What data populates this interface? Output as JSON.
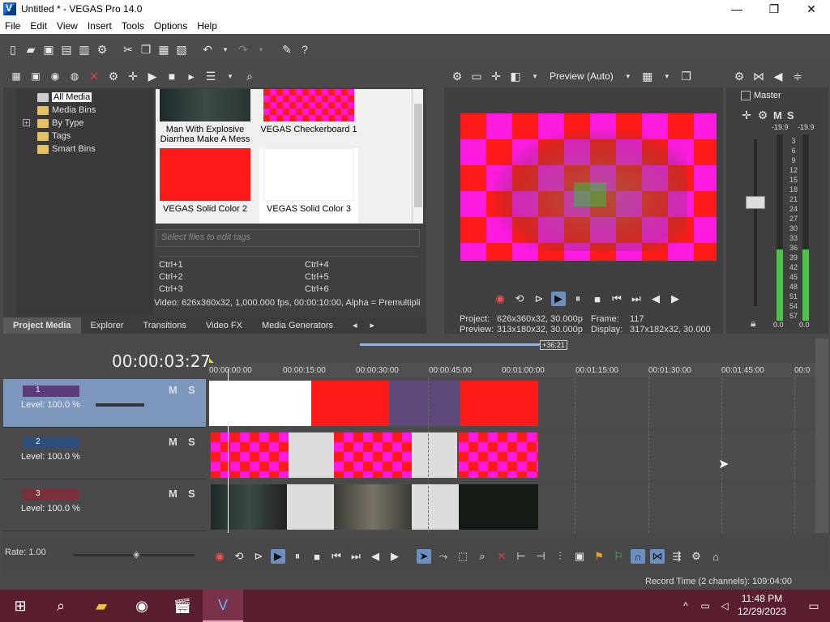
{
  "window": {
    "title": "Untitled * - VEGAS Pro 14.0",
    "minimize": "—",
    "maximize": "❐",
    "close": "✕"
  },
  "menu": [
    "File",
    "Edit",
    "View",
    "Insert",
    "Tools",
    "Options",
    "Help"
  ],
  "project_media": {
    "tree": [
      "All Media",
      "Media Bins",
      "By Type",
      "Tags",
      "Smart Bins"
    ],
    "thumbnails": [
      {
        "label_line1": "Man With Explosive",
        "label_line2": "Diarrhea Make A Mess ..."
      },
      {
        "label_line1": "VEGAS Checkerboard 1",
        "label_line2": ""
      },
      {
        "label_line1": "VEGAS Solid Color 2",
        "label_line2": ""
      },
      {
        "label_line1": "VEGAS Solid Color 3",
        "label_line2": ""
      }
    ],
    "tag_placeholder": "Select files to edit tags",
    "shortcuts": [
      "Ctrl+1",
      "Ctrl+2",
      "Ctrl+3",
      "Ctrl+4",
      "Ctrl+5",
      "Ctrl+6"
    ],
    "info": "Video: 626x360x32, 1,000.000 fps, 00:00:10:00, Alpha = Premultipli",
    "tabs": [
      "Project Media",
      "Explorer",
      "Transitions",
      "Video FX",
      "Media Generators"
    ]
  },
  "preview": {
    "mode": "Preview (Auto)",
    "project_label": "Project:",
    "project_value": "626x360x32, 30.000p",
    "preview_label": "Preview:",
    "preview_value": "313x180x32, 30.000p",
    "frame_label": "Frame:",
    "frame_value": "117",
    "display_label": "Display:",
    "display_value": "317x182x32, 30.000"
  },
  "master": {
    "title": "Master",
    "m_label": "M",
    "s_label": "S",
    "peak_left": "-19.9",
    "peak_right": "-19.9",
    "scale": [
      "3",
      "6",
      "9",
      "12",
      "15",
      "18",
      "21",
      "24",
      "27",
      "30",
      "33",
      "36",
      "39",
      "42",
      "45",
      "48",
      "51",
      "54",
      "57"
    ],
    "bottom_left": "0.0",
    "bottom_right": "0.0"
  },
  "timeline": {
    "timecode": "00:00:03:27",
    "region_length": "+36:21",
    "ruler": [
      "00:00:00:00",
      "00:00:15:00",
      "00:00:30:00",
      "00:00:45:00",
      "00:01:00:00",
      "00:01:15:00",
      "00:01:30:00",
      "00:01:45:00",
      "00:0"
    ],
    "tracks": [
      {
        "number": "1",
        "level": "Level: 100.0 %",
        "m": "M",
        "s": "S"
      },
      {
        "number": "2",
        "level": "Level: 100.0 %",
        "m": "M",
        "s": "S"
      },
      {
        "number": "3",
        "level": "Level: 100.0 %",
        "m": "M",
        "s": "S"
      }
    ]
  },
  "bottom": {
    "rate": "Rate: 1.00",
    "record_time": "Record Time (2 channels): 109:04:00"
  },
  "taskbar": {
    "time": "11:48 PM",
    "date": "12/29/2023"
  },
  "colors": {
    "red": "#ff1a1a",
    "magenta": "#ff1ae0",
    "selected_track": "#7e98bd",
    "taskbar": "#5a1f2e"
  }
}
